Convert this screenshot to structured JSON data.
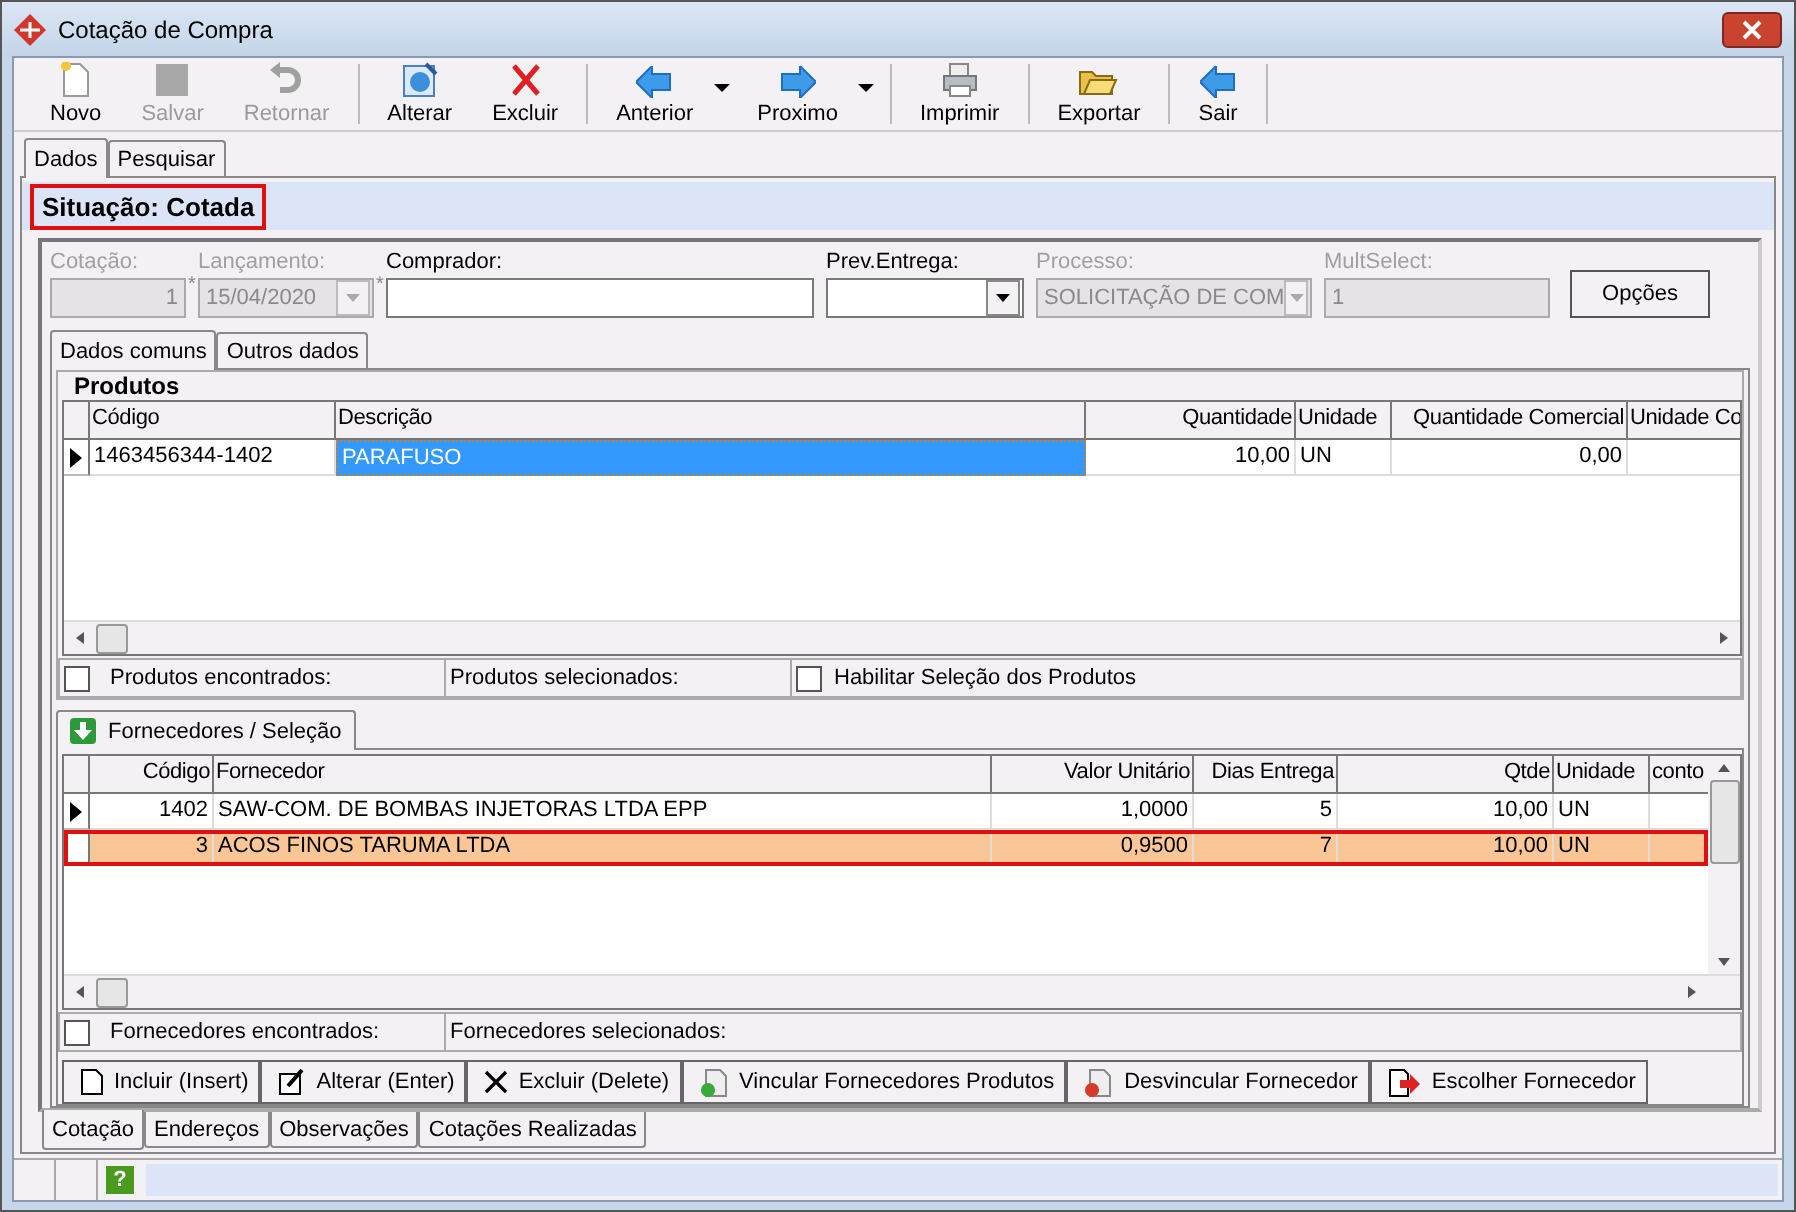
{
  "window": {
    "title": "Cotação de Compra"
  },
  "toolbar": [
    [
      {
        "label": "Novo",
        "kind": "new",
        "disabled": false,
        "dropdown": false
      },
      {
        "label": "Salvar",
        "kind": "save",
        "disabled": true,
        "dropdown": false
      },
      {
        "label": "Retornar",
        "kind": "undo",
        "disabled": true,
        "dropdown": false
      }
    ],
    [
      {
        "label": "Alterar",
        "kind": "edit",
        "disabled": false,
        "dropdown": false
      },
      {
        "label": "Excluir",
        "kind": "delete",
        "disabled": false,
        "dropdown": false
      }
    ],
    [
      {
        "label": "Anterior",
        "kind": "prev",
        "disabled": false,
        "dropdown": true
      },
      {
        "label": "Proximo",
        "kind": "next",
        "disabled": false,
        "dropdown": true
      }
    ],
    [
      {
        "label": "Imprimir",
        "kind": "print",
        "disabled": false,
        "dropdown": false
      }
    ],
    [
      {
        "label": "Exportar",
        "kind": "export",
        "disabled": false,
        "dropdown": false
      }
    ],
    [
      {
        "label": "Sair",
        "kind": "exit",
        "disabled": false,
        "dropdown": false
      }
    ]
  ],
  "tabs": [
    {
      "label": "Dados",
      "selected": true
    },
    {
      "label": "Pesquisar",
      "selected": false
    }
  ],
  "situacao": "Situação: Cotada",
  "fields": [
    {
      "label": "Cotação:",
      "value": "1",
      "kind": "number",
      "disabled": true
    },
    {
      "marker": "*",
      "label": "Lançamento:",
      "value": "15/04/2020",
      "kind": "combo",
      "disabled": true
    },
    {
      "marker": "*",
      "label": "Comprador:",
      "kind": "text",
      "disabled": false
    },
    {
      "label": "Prev.Entrega:",
      "kind": "combo",
      "disabled": false
    },
    {
      "label": "Processo:",
      "value": "SOLICITAÇÃO DE COM",
      "kind": "combo",
      "disabled": true
    },
    {
      "label": "MultSelect:",
      "value": "1",
      "kind": "text",
      "disabled": true
    }
  ],
  "options_button": "Opções",
  "inner_tabs": [
    {
      "label": "Dados comuns",
      "selected": true
    },
    {
      "label": "Outros dados",
      "selected": false
    }
  ],
  "produtos": {
    "title": "Produtos",
    "columns": [
      {
        "label": "Código",
        "numeric": false
      },
      {
        "label": "Descrição",
        "numeric": false
      },
      {
        "label": "Quantidade",
        "numeric": true
      },
      {
        "label": "Unidade",
        "numeric": false
      },
      {
        "label": "Quantidade Comercial",
        "numeric": true
      },
      {
        "label": "Unidade Co",
        "numeric": false
      }
    ],
    "rows": [
      {
        "current": true,
        "selected": false,
        "cells": [
          {
            "text": "1463456344-1402",
            "focused": false
          },
          {
            "text": "PARAFUSO",
            "focused": true
          },
          {
            "text": "10,00",
            "focused": false
          },
          {
            "text": "UN",
            "focused": false
          },
          {
            "text": "0,00",
            "focused": false
          },
          {
            "focused": false
          }
        ]
      }
    ],
    "footer": [
      {
        "kind": "checkbox",
        "label": "Produtos encontrados:",
        "checked": false
      },
      {
        "kind": "label",
        "label": "Produtos selecionados:"
      },
      {
        "kind": "checkbox",
        "label": "Habilitar Seleção dos Produtos",
        "checked": false
      }
    ]
  },
  "fornecedores": {
    "tab": "Fornecedores / Seleção",
    "columns": [
      {
        "label": "Código",
        "numeric": true
      },
      {
        "label": "Fornecedor",
        "numeric": false
      },
      {
        "label": "Valor Unitário",
        "numeric": true
      },
      {
        "label": "Dias Entrega",
        "numeric": true
      },
      {
        "label": "Qtde",
        "numeric": true
      },
      {
        "label": "Unidade",
        "numeric": false
      },
      {
        "label": "conto",
        "numeric": false
      }
    ],
    "rows": [
      {
        "current": true,
        "selected": false,
        "cells": [
          {
            "text": "1402",
            "focused": false
          },
          {
            "text": "SAW-COM. DE BOMBAS INJETORAS LTDA EPP",
            "focused": false
          },
          {
            "text": "1,0000",
            "focused": false
          },
          {
            "text": "5",
            "focused": false
          },
          {
            "text": "10,00",
            "focused": false
          },
          {
            "text": "UN",
            "focused": false
          },
          {
            "focused": false
          }
        ]
      },
      {
        "current": false,
        "selected": true,
        "cells": [
          {
            "text": "3",
            "focused": false
          },
          {
            "text": "ACOS FINOS TARUMA LTDA",
            "focused": false
          },
          {
            "text": "0,9500",
            "focused": false
          },
          {
            "text": "7",
            "focused": false
          },
          {
            "text": "10,00",
            "focused": false
          },
          {
            "text": "UN",
            "focused": false
          },
          {
            "focused": false
          }
        ]
      }
    ],
    "footer": [
      {
        "kind": "checkbox",
        "label": "Fornecedores encontrados:",
        "checked": false
      },
      {
        "kind": "label",
        "label": "Fornecedores selecionados:"
      }
    ],
    "buttons": [
      {
        "label": "Incluir (Insert)",
        "kind": "new"
      },
      {
        "label": "Alterar (Enter)",
        "kind": "edit"
      },
      {
        "label": "Excluir (Delete)",
        "kind": "delete"
      },
      {
        "label": "Vincular Fornecedores Produtos",
        "kind": "link"
      },
      {
        "label": "Desvincular Fornecedor",
        "kind": "unlink"
      },
      {
        "label": "Escolher Fornecedor",
        "kind": "choose"
      }
    ]
  },
  "bottom_tabs": [
    {
      "label": "Cotação",
      "selected": true
    },
    {
      "label": "Endereços",
      "selected": false
    },
    {
      "label": "Observações",
      "selected": false
    },
    {
      "label": "Cotações Realizadas",
      "selected": false
    }
  ],
  "status_bar": {
    "help": "?"
  }
}
